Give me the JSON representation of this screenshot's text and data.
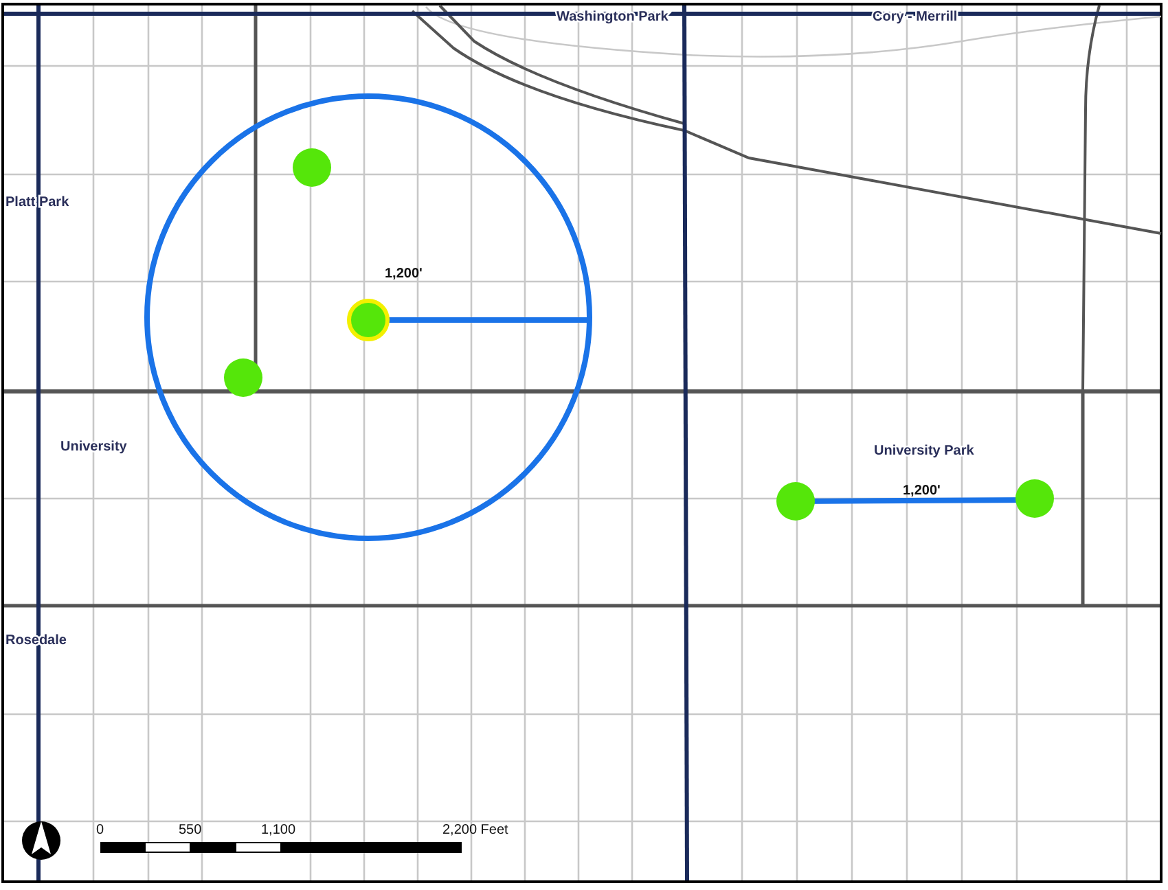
{
  "map": {
    "neighborhoods": [
      {
        "label": "Washington Park"
      },
      {
        "label": "Cory - Merrill"
      },
      {
        "label": "Platt Park"
      },
      {
        "label": "University"
      },
      {
        "label": "Rosedale"
      },
      {
        "label": "University Park"
      }
    ],
    "distance_labels": [
      "1,200'",
      "1,200'"
    ],
    "sites": [
      {
        "highlighted": false
      },
      {
        "highlighted": true
      },
      {
        "highlighted": false
      },
      {
        "highlighted": false
      },
      {
        "highlighted": false
      }
    ],
    "scale_bar": {
      "ticks": [
        "0",
        "550",
        "1,100"
      ],
      "end_label": "2,200 Feet"
    }
  }
}
